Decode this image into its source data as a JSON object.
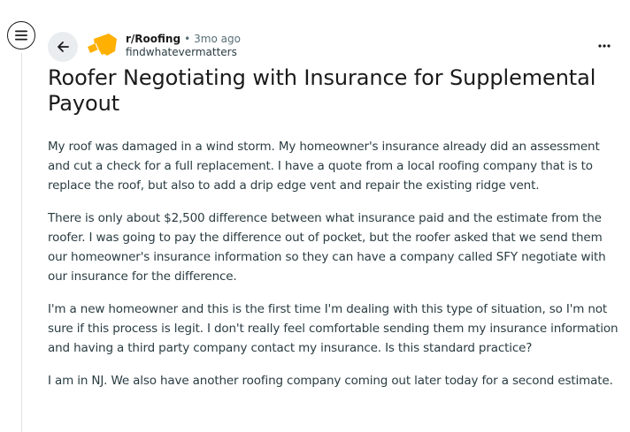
{
  "post": {
    "subreddit": "r/Roofing",
    "separator": "•",
    "age": "3mo ago",
    "author": "findwhatevermatters",
    "title": "Roofer Negotiating with Insurance for Supplemental Payout",
    "paragraphs": [
      "My roof was damaged in a wind storm. My homeowner's insurance already did an assessment and cut a check for a full replacement. I have a quote from a local roofing company that is to replace the roof, but also to add a drip edge vent and repair the existing ridge vent.",
      "There is only about $2,500 difference between what insurance paid and the estimate from the roofer. I was going to pay the difference out of pocket, but the roofer asked that we send them our homeowner's insurance information so they can have a company called SFY negotiate with our insurance for the difference.",
      "I'm a new homeowner and this is the first time I'm dealing with this type of situation, so I'm not sure if this process is legit. I don't really feel comfortable sending them my insurance information and having a third party company contact my insurance. Is this standard practice?",
      "I am in NJ. We also have another roofing company coming out later today for a second estimate."
    ]
  },
  "icons": {
    "menu": "hamburger-menu-icon",
    "back": "arrow-left-icon",
    "avatar": "subreddit-avatar-icon",
    "more": "ellipsis-icon"
  },
  "colors": {
    "text": "#1a1a1b",
    "body_text": "#2a3c42",
    "meta_text": "#576f76",
    "back_button_bg": "#eaedef",
    "avatar_orange": "#ffb000"
  }
}
